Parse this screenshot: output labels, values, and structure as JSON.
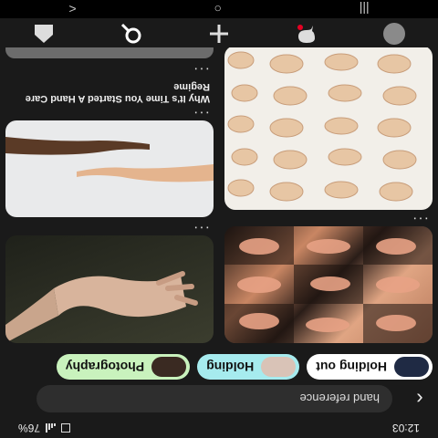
{
  "status_bar": {
    "time": "12:03",
    "battery": "76%"
  },
  "search": {
    "back_icon": "chevron-left-icon",
    "query": "hand reference"
  },
  "chips": [
    {
      "label": "Holding out",
      "bg": "#ffffff",
      "thumb_color": "#1f2a44"
    },
    {
      "label": "Holding",
      "bg": "#a6ebee",
      "thumb_color": "#d9c3b7"
    },
    {
      "label": "Photography",
      "bg": "#c9f2bd",
      "thumb_color": "#3a2a22"
    }
  ],
  "pins": [
    {
      "title": "",
      "more": "···"
    },
    {
      "title": "",
      "more": "···"
    },
    {
      "title": "",
      "more": "···"
    },
    {
      "title": "Why It's Time You Started A Hand Care Regime",
      "more": "···"
    },
    {
      "title": "",
      "more": "···"
    }
  ],
  "bottom_nav": {
    "items": [
      "profile-icon",
      "messages-icon",
      "add-icon",
      "search-icon",
      "home-icon"
    ],
    "notification_color": "#e60023"
  },
  "system_nav": {
    "recents": "|||",
    "home": "○",
    "back": "<"
  }
}
